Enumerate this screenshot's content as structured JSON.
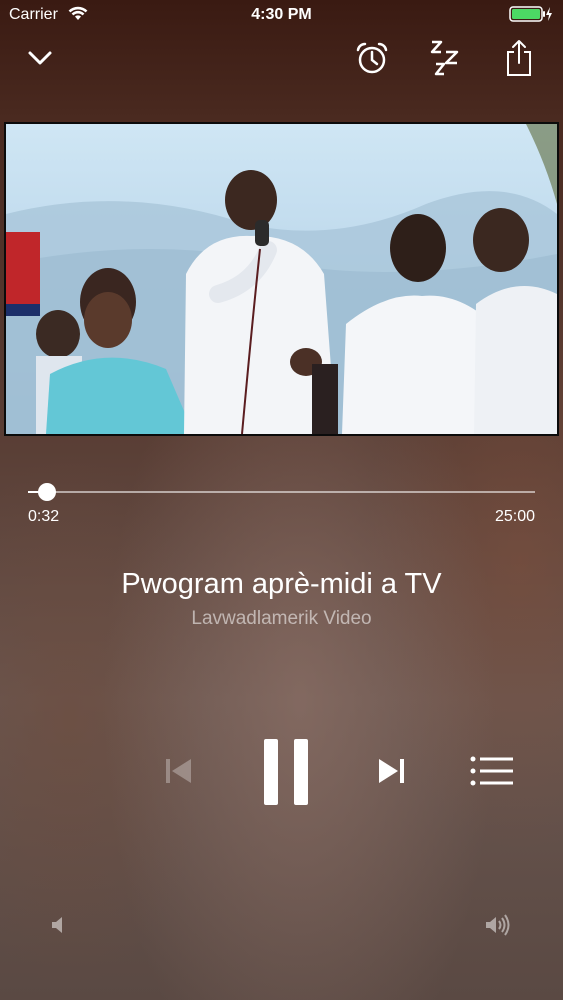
{
  "status": {
    "carrier": "Carrier",
    "time": "4:30 PM"
  },
  "icons": {
    "collapse": "chevron-down-icon",
    "alarm": "alarm-clock-icon",
    "sleep": "sleep-zzz-icon",
    "share": "share-icon",
    "previous": "skip-previous-icon",
    "pause": "pause-icon",
    "next": "skip-next-icon",
    "queue": "list-icon",
    "volume_low": "speaker-low-icon",
    "volume_high": "speaker-high-icon"
  },
  "player": {
    "elapsed": "0:32",
    "duration": "25:00",
    "progress_fraction": 0.0213,
    "title": "Pwogram aprè-midi a TV",
    "subtitle": "Lavwadlamerik Video"
  }
}
